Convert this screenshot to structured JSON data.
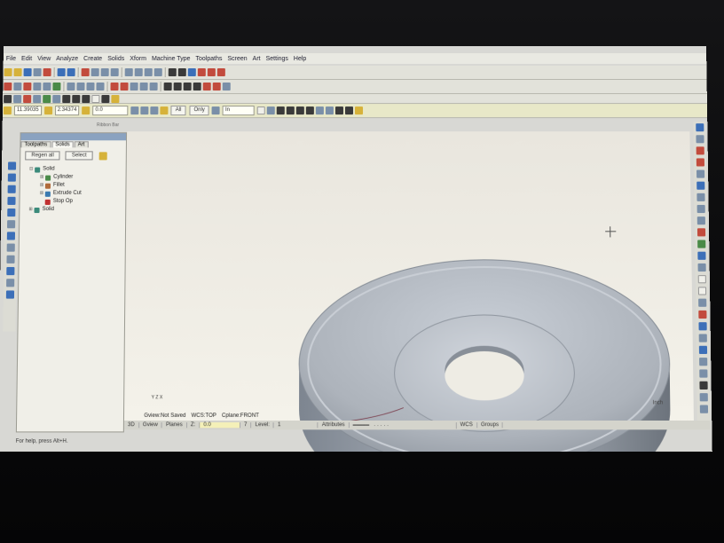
{
  "menu": [
    "File",
    "Edit",
    "View",
    "Analyze",
    "Create",
    "Solids",
    "Xform",
    "Machine Type",
    "Toolpaths",
    "Screen",
    "Art",
    "Settings",
    "Help"
  ],
  "ribbon": {
    "field1": "11.39035",
    "field2": "2.34374",
    "field3": "0.0",
    "all_button": "All",
    "only_button": "Only",
    "in_dropdown": "In",
    "label": "Ribbon Bar"
  },
  "manager": {
    "tabs": [
      "Toolpaths",
      "Solids",
      "Art"
    ],
    "regen_button": "Regen all",
    "select_button": "Select",
    "tree": [
      {
        "label": "Solid",
        "level": 0,
        "icon": "solid-icon",
        "expand": "⊟"
      },
      {
        "label": "Cylinder",
        "level": 1,
        "icon": "cylinder-icon",
        "expand": "⊞"
      },
      {
        "label": "Fillet",
        "level": 1,
        "icon": "fillet-icon",
        "expand": "⊞"
      },
      {
        "label": "Extrude Cut",
        "level": 1,
        "icon": "extrude-cut-icon",
        "expand": "⊞"
      },
      {
        "label": "Stop Op",
        "level": 1,
        "icon": "stop-op-icon",
        "expand": ""
      },
      {
        "label": "Solid",
        "level": 0,
        "icon": "solid-icon",
        "expand": "⊞"
      }
    ]
  },
  "viewport": {
    "gview": "Gview:Not Saved",
    "wcs": "WCS:TOP",
    "cplane": "Cplane:FRONT",
    "units": "Inch",
    "axis_y": "Y",
    "axis_z": "Z",
    "axis_x": "X"
  },
  "status": {
    "3d": "3D",
    "gview": "Gview",
    "planes": "Planes",
    "z": "Z:",
    "z_value": "0.0",
    "level_value": "7",
    "level": "Level:",
    "level_num": "1",
    "attributes": "Attributes",
    "wcs": "WCS",
    "groups": "Groups"
  },
  "help_text": "For help, press Alt+H.",
  "colors": {
    "viewport_bg": "#eeece4",
    "part": "#b4bac2",
    "accent": "#3c6fb8"
  }
}
